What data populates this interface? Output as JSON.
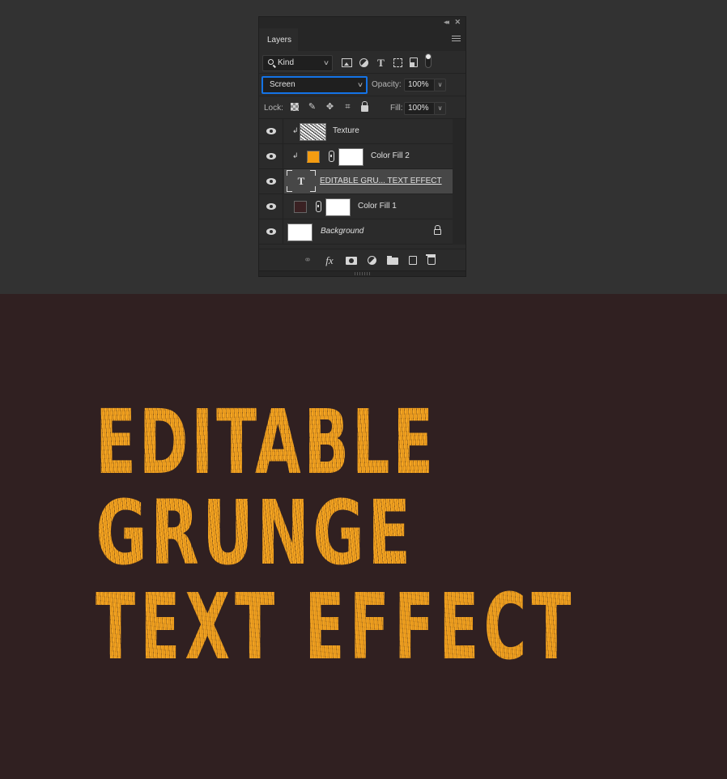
{
  "panel": {
    "collapse_icon": "double-chevron-left-icon",
    "close_icon": "close-icon",
    "tab_label": "Layers",
    "menu_icon": "hamburger-menu-icon",
    "filter": {
      "kind_label": "Kind",
      "icons": [
        "image-filter-icon",
        "adjustment-filter-icon",
        "type-filter-icon",
        "shape-filter-icon",
        "smart-object-filter-icon",
        "filter-toggle-icon"
      ]
    },
    "blend_mode": "Screen",
    "opacity_label": "Opacity:",
    "opacity_value": "100%",
    "lock_label": "Lock:",
    "lock_icons": [
      "lock-transparent-pixels-icon",
      "lock-image-pixels-icon",
      "lock-position-icon",
      "lock-artboard-icon",
      "lock-all-icon"
    ],
    "fill_label": "Fill:",
    "fill_value": "100%",
    "layers": [
      {
        "name": "Texture",
        "type": "texture",
        "clipped": true,
        "visible": true,
        "selected": false
      },
      {
        "name": "Color Fill 2",
        "type": "color-fill",
        "color": "#f39c12",
        "clipped": true,
        "visible": true,
        "selected": false
      },
      {
        "name": "EDITABLE GRU... TEXT EFFECT",
        "type": "text",
        "clipped": false,
        "visible": true,
        "selected": true
      },
      {
        "name": "Color Fill 1",
        "type": "color-fill",
        "color": "#3a2123",
        "clipped": false,
        "visible": true,
        "selected": false
      },
      {
        "name": "Background",
        "type": "background",
        "locked": true,
        "visible": true,
        "selected": false
      }
    ],
    "footer_icons": [
      "link-layers-icon",
      "fx-icon",
      "add-mask-icon",
      "new-adjustment-layer-icon",
      "new-group-icon",
      "new-layer-icon",
      "delete-layer-icon"
    ]
  },
  "canvas": {
    "lines": [
      "EDITABLE",
      "GRUNGE",
      "TEXT EFFECT"
    ],
    "text_color": "#f5a623",
    "background_color": "#302021"
  }
}
